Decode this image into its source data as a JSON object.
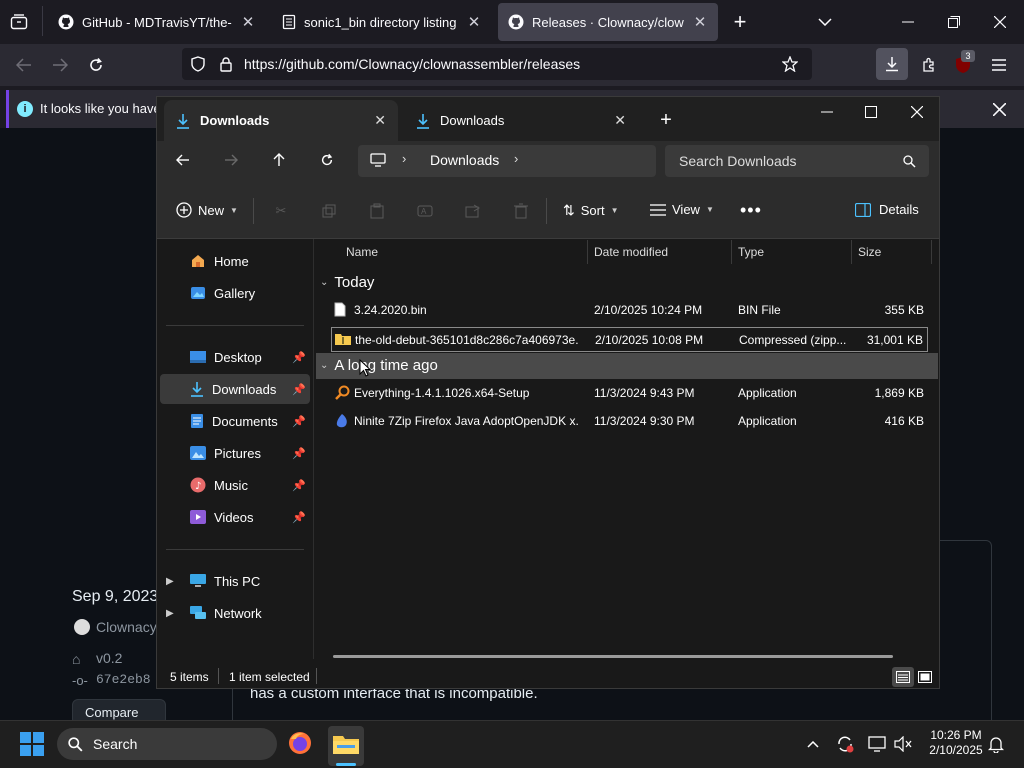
{
  "firefox": {
    "tabs": [
      {
        "title": "GitHub - MDTravisYT/the-old-d"
      },
      {
        "title": "sonic1_bin directory listing"
      },
      {
        "title": "Releases · Clownacy/clownasse"
      }
    ],
    "url": "https://github.com/Clownacy/clownassembler/releases",
    "notification": "It looks like you haven",
    "extensions_badge": "3"
  },
  "github": {
    "date": "Sep 9, 2023",
    "user": "Clownacy",
    "tag": "v0.2",
    "commit": "67e2eb8",
    "compare_label": "Compare",
    "body_text": "has a custom interface that is incompatible."
  },
  "explorer": {
    "tabs": [
      {
        "label": "Downloads"
      },
      {
        "label": "Downloads"
      }
    ],
    "breadcrumb": "Downloads",
    "search_placeholder": "Search Downloads",
    "toolbar": {
      "new_label": "New",
      "sort_label": "Sort",
      "view_label": "View",
      "details_label": "Details"
    },
    "nav": {
      "quick": [
        {
          "label": "Home"
        },
        {
          "label": "Gallery"
        }
      ],
      "pinned": [
        {
          "label": "Desktop"
        },
        {
          "label": "Downloads"
        },
        {
          "label": "Documents"
        },
        {
          "label": "Pictures"
        },
        {
          "label": "Music"
        },
        {
          "label": "Videos"
        }
      ],
      "locations": [
        {
          "label": "This PC"
        },
        {
          "label": "Network"
        }
      ]
    },
    "columns": {
      "name": "Name",
      "date": "Date modified",
      "type": "Type",
      "size": "Size"
    },
    "groups": [
      {
        "label": "Today",
        "files": [
          {
            "name": "3.24.2020.bin",
            "date": "2/10/2025 10:24 PM",
            "type": "BIN File",
            "size": "355 KB"
          },
          {
            "name": "the-old-debut-365101d8c286c7a406973e...",
            "date": "2/10/2025 10:08 PM",
            "type": "Compressed (zipp...",
            "size": "31,001 KB"
          }
        ]
      },
      {
        "label": "A long time ago",
        "files": [
          {
            "name": "Everything-1.4.1.1026.x64-Setup",
            "date": "11/3/2024 9:43 PM",
            "type": "Application",
            "size": "1,869 KB"
          },
          {
            "name": "Ninite 7Zip Firefox Java AdoptOpenJDK x...",
            "date": "11/3/2024 9:30 PM",
            "type": "Application",
            "size": "416 KB"
          }
        ]
      }
    ],
    "status": {
      "items": "5 items",
      "selected": "1 item selected"
    }
  },
  "taskbar": {
    "search_placeholder": "Search",
    "time": "10:26 PM",
    "date": "2/10/2025"
  }
}
